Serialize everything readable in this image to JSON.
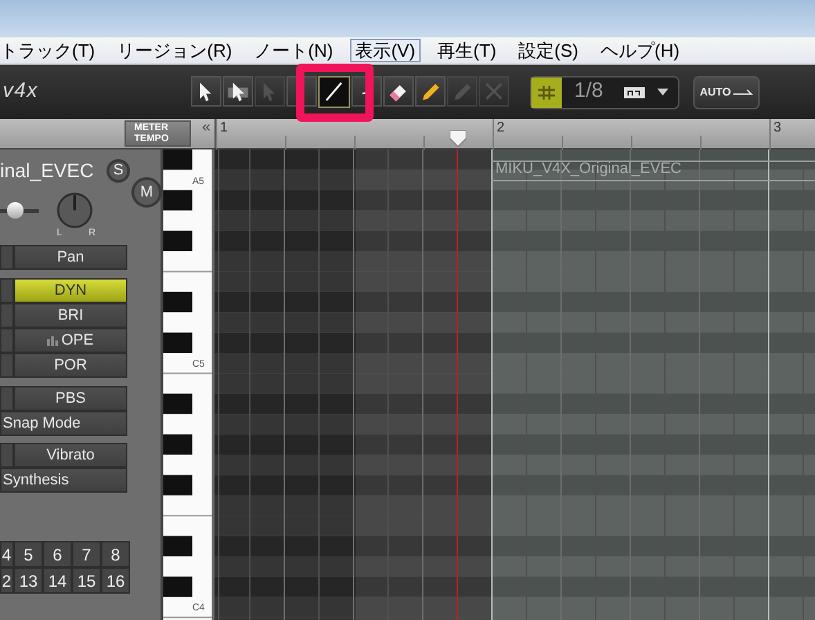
{
  "menu": [
    {
      "label": "トラック(T)",
      "selected": false
    },
    {
      "label": "リージョン(R)",
      "selected": false
    },
    {
      "label": "ノート(N)",
      "selected": false
    },
    {
      "label": "表示(V)",
      "selected": true
    },
    {
      "label": "再生(T)",
      "selected": false
    },
    {
      "label": "設定(S)",
      "selected": false
    },
    {
      "label": "ヘルプ(H)",
      "selected": false
    }
  ],
  "toolbar": {
    "logo": "v4x",
    "tools": [
      {
        "kind": "arrow",
        "selected": false,
        "disabled": false
      },
      {
        "kind": "arrow-box",
        "selected": false,
        "disabled": false
      },
      {
        "kind": "arrow",
        "selected": false,
        "disabled": true
      },
      {
        "kind": "pen-small",
        "selected": false,
        "disabled": false
      },
      {
        "kind": "line",
        "selected": true,
        "disabled": false
      },
      {
        "kind": "curve",
        "selected": false,
        "disabled": false
      },
      {
        "kind": "eraser",
        "selected": false,
        "disabled": false
      },
      {
        "kind": "pencil",
        "selected": false,
        "disabled": false
      },
      {
        "kind": "pencil",
        "selected": false,
        "disabled": true
      },
      {
        "kind": "cross",
        "selected": false,
        "disabled": true
      }
    ],
    "grid_snap": {
      "on": true
    },
    "quantize": "1/8",
    "auto_button": "AUTO"
  },
  "ruler": {
    "meter_tempo": [
      "METER",
      "TEMPO"
    ],
    "collapse": "«",
    "bars": [
      "1",
      "2",
      "3"
    ]
  },
  "track": {
    "name": "inal_EVEC",
    "solo": "S",
    "mute": "M",
    "volume": {
      "level": 0.3
    },
    "pan_labels": [
      "L",
      "R"
    ]
  },
  "parameters": [
    [
      {
        "label": "Pan",
        "selected": false,
        "stub": true
      }
    ],
    [
      {
        "label": "DYN",
        "selected": true,
        "stub": true
      },
      {
        "label": "BRI",
        "selected": false,
        "stub": true
      },
      {
        "label": "OPE",
        "selected": false,
        "stub": true,
        "meter": true
      },
      {
        "label": "POR",
        "selected": false,
        "stub": true
      }
    ],
    [
      {
        "label": "PBS",
        "selected": false,
        "stub": true
      },
      {
        "label": "Snap Mode",
        "selected": false,
        "stub": false
      }
    ],
    [
      {
        "label": "Vibrato",
        "selected": false,
        "stub": true
      },
      {
        "label": "Synthesis",
        "selected": false,
        "stub": false
      }
    ]
  ],
  "number_pad": [
    [
      "4",
      "5",
      "6",
      "7",
      "8"
    ],
    [
      "2",
      "13",
      "14",
      "15",
      "16"
    ]
  ],
  "piano_labels": [
    "A5",
    "C5",
    "C4"
  ],
  "region": {
    "label": "MIKU_V4X_Original_EVEC"
  },
  "highlight": {
    "on": true
  }
}
